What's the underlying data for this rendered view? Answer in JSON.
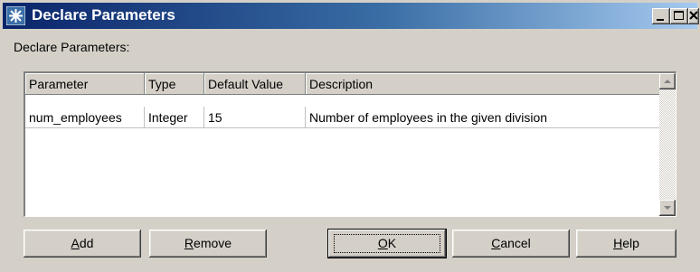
{
  "window": {
    "title": "Declare Parameters",
    "controls": [
      "minimize-icon",
      "maximize-icon",
      "close-icon"
    ]
  },
  "section_label": "Declare Parameters:",
  "table": {
    "columns": [
      "Parameter",
      "Type",
      "Default Value",
      "Description"
    ],
    "rows": [
      [
        "num_employees",
        "Integer",
        "15",
        "Number of employees in the given division"
      ]
    ]
  },
  "buttons": {
    "add": {
      "mnemonic": "A",
      "rest": "dd"
    },
    "remove": {
      "mnemonic": "R",
      "rest": "emove"
    },
    "ok": {
      "mnemonic": "O",
      "rest": "K"
    },
    "cancel": {
      "mnemonic": "C",
      "rest": "ancel"
    },
    "help": {
      "mnemonic": "H",
      "rest": "elp"
    }
  },
  "colors": {
    "titlebar_start": "#0a246a",
    "titlebar_end": "#a6caf0",
    "face": "#d4d0c8"
  }
}
